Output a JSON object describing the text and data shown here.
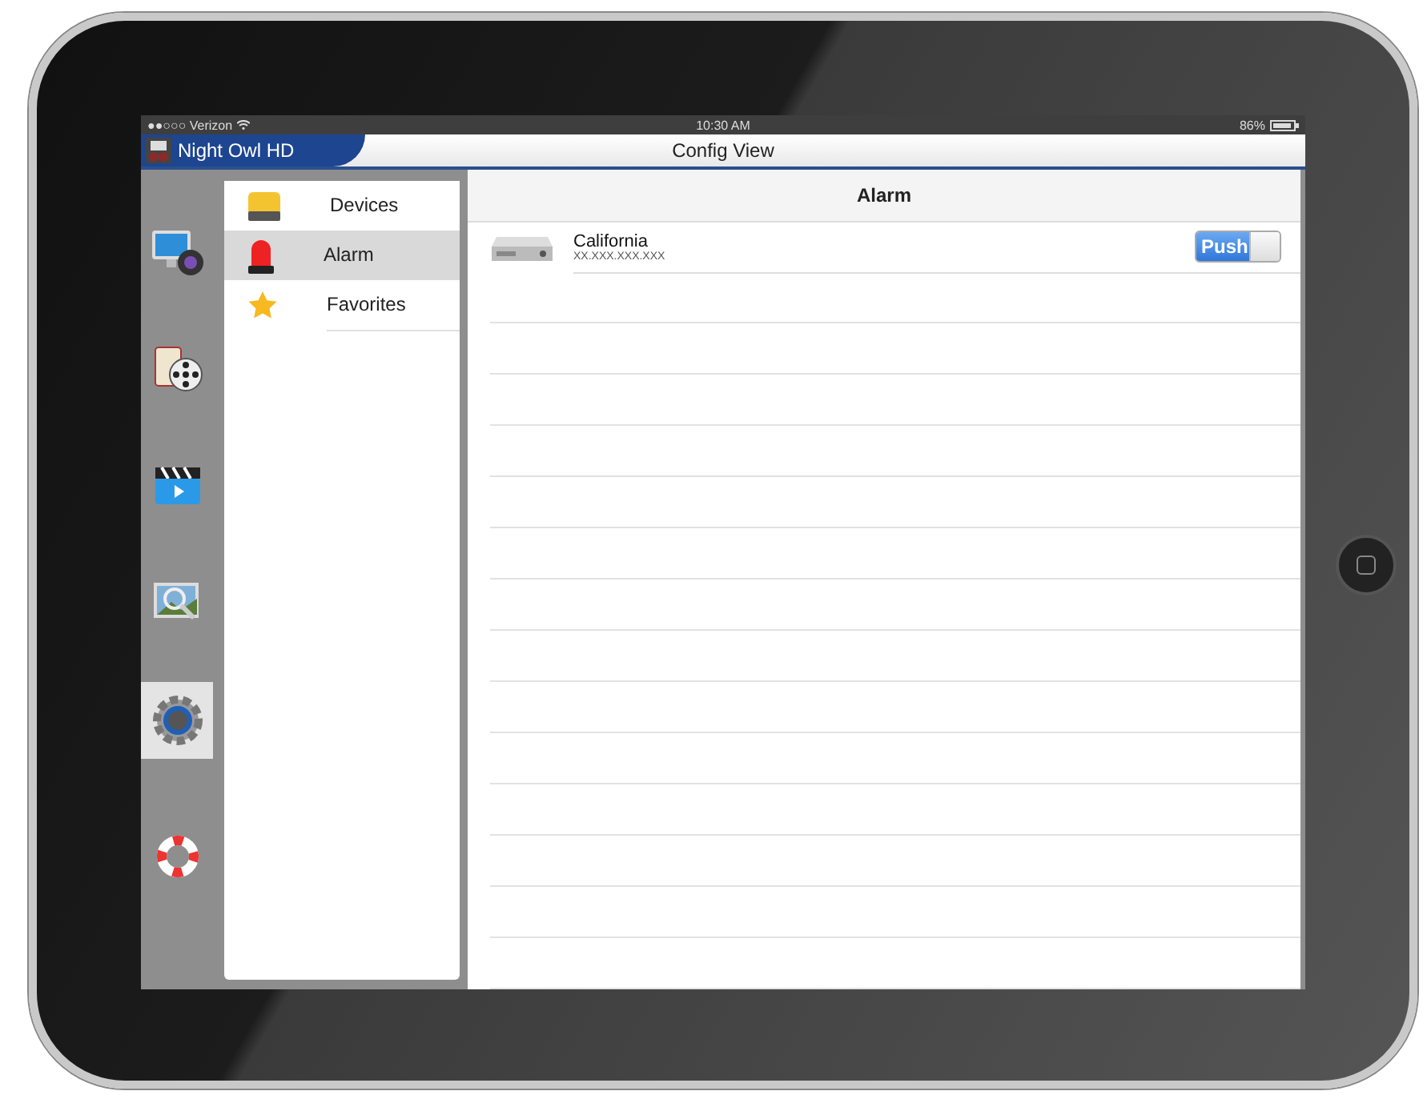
{
  "status_bar": {
    "carrier": "●●○○○ Verizon",
    "time": "10:30 AM",
    "battery": "86%"
  },
  "nav_bar": {
    "app_name": "Night Owl HD",
    "title": "Config View"
  },
  "rail": [
    {
      "kind": "live",
      "selected": false
    },
    {
      "kind": "playback",
      "selected": false
    },
    {
      "kind": "video",
      "selected": false
    },
    {
      "kind": "snapshot",
      "selected": false
    },
    {
      "kind": "settings",
      "selected": true
    },
    {
      "kind": "help",
      "selected": false
    }
  ],
  "menu": [
    {
      "kind": "devices",
      "label": "Devices",
      "selected": false
    },
    {
      "kind": "alarm",
      "label": "Alarm",
      "selected": true
    },
    {
      "kind": "favorites",
      "label": "Favorites",
      "selected": false
    }
  ],
  "detail": {
    "title": "Alarm",
    "rows": [
      {
        "name": "California",
        "address": "XX.XXX.XXX.XXX",
        "push": {
          "label": "Push",
          "on": true
        }
      }
    ]
  }
}
